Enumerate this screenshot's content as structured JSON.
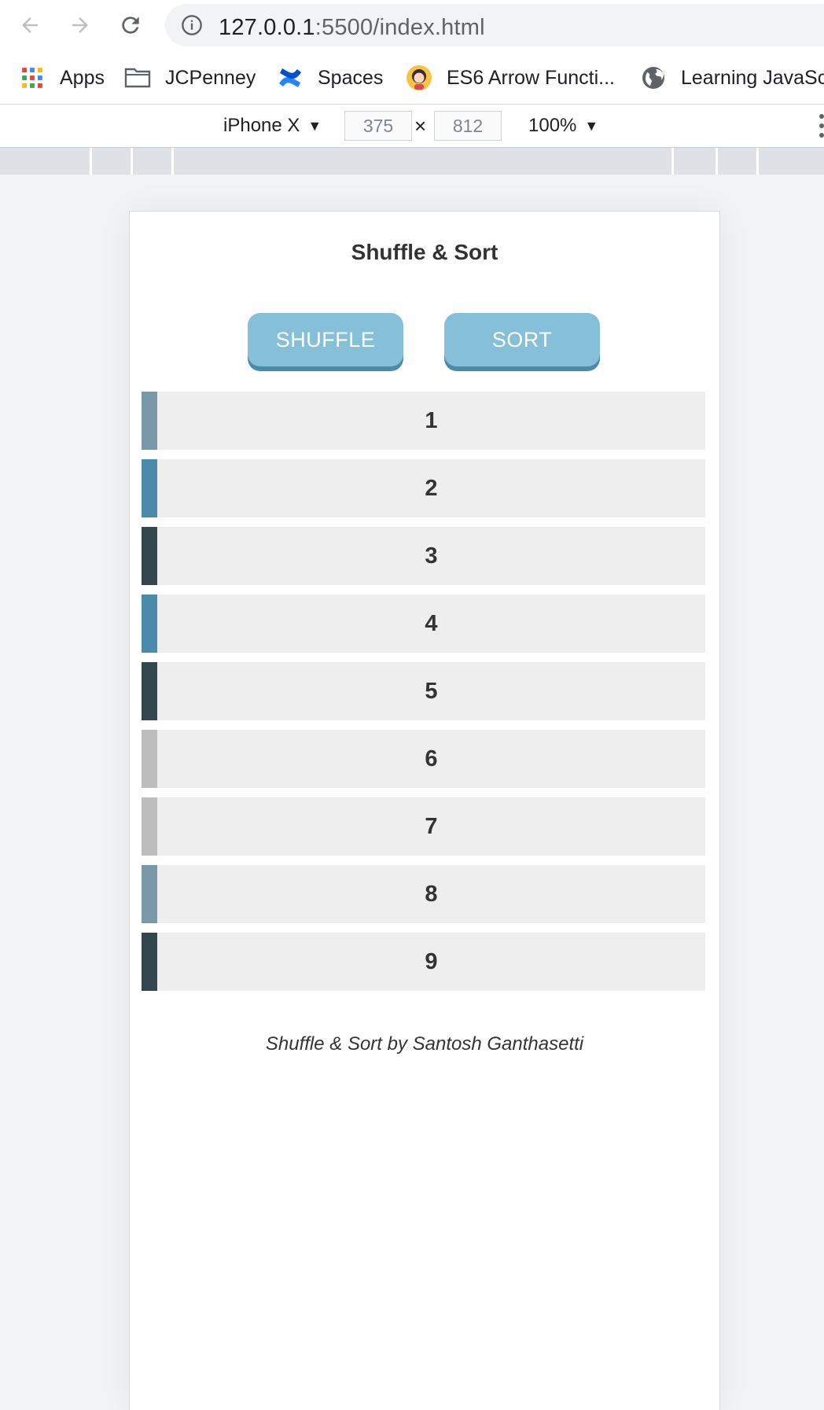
{
  "browser": {
    "url_host": "127.0.0.1",
    "url_rest": ":5500/index.html"
  },
  "bookmarks": [
    {
      "label": "Apps",
      "icon": "apps-grid-icon"
    },
    {
      "label": "JCPenney",
      "icon": "folder-icon"
    },
    {
      "label": "Spaces",
      "icon": "confluence-icon"
    },
    {
      "label": "ES6 Arrow Functi...",
      "icon": "avatar-icon"
    },
    {
      "label": "Learning JavaSc",
      "icon": "globe-icon"
    }
  ],
  "devtools": {
    "device": "iPhone X",
    "width": "375",
    "height": "812",
    "times": "×",
    "zoom": "100%"
  },
  "app": {
    "title": "Shuffle & Sort",
    "shuffle_label": "SHUFFLE",
    "sort_label": "SORT",
    "footer": "Shuffle & Sort by Santosh Ganthasetti",
    "items": [
      {
        "value": "1",
        "color": "#7a99a8"
      },
      {
        "value": "2",
        "color": "#4a8bab"
      },
      {
        "value": "3",
        "color": "#34474f"
      },
      {
        "value": "4",
        "color": "#4a8bab"
      },
      {
        "value": "5",
        "color": "#34474f"
      },
      {
        "value": "6",
        "color": "#bdbdbd"
      },
      {
        "value": "7",
        "color": "#bdbdbd"
      },
      {
        "value": "8",
        "color": "#7a99a8"
      },
      {
        "value": "9",
        "color": "#34474f"
      }
    ]
  }
}
